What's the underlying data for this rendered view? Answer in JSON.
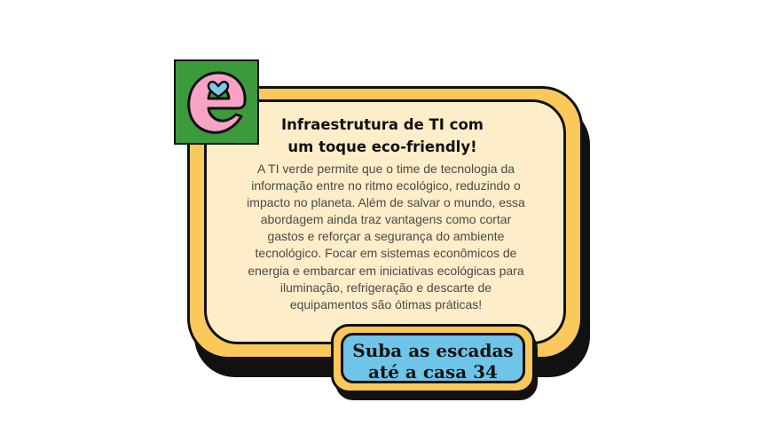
{
  "card": {
    "title_line1": "Infraestrutura de TI com",
    "title_line2": "um toque eco-friendly!",
    "body_lines": [
      "A TI verde permite que o time de tecnologia da",
      "informação entre no ritmo ecológico, reduzindo o",
      "impacto no planeta. Além de salvar o mundo, essa",
      "abordagem ainda traz vantagens como cortar",
      "gastos e reforçar a segurança do ambiente",
      "tecnológico. Focar em sistemas econômicos de",
      "energia e embarcar em iniciativas ecológicas para",
      "iluminação, refrigeração e descarte de",
      "equipamentos são ótimas práticas!"
    ]
  },
  "logo": {
    "icon": "letter-e-heart-icon",
    "letter": "e"
  },
  "badge": {
    "line1": "Suba as escadas",
    "line2": "até a casa 34"
  },
  "colors": {
    "card_frame": "#fbc85c",
    "card_fill": "#fdedc8",
    "outline": "#111111",
    "logo_bg": "#3b9a3c",
    "logo_letter": "#f6a3c6",
    "logo_heart": "#7cc8ee",
    "badge_fill": "#6fc5e8"
  }
}
